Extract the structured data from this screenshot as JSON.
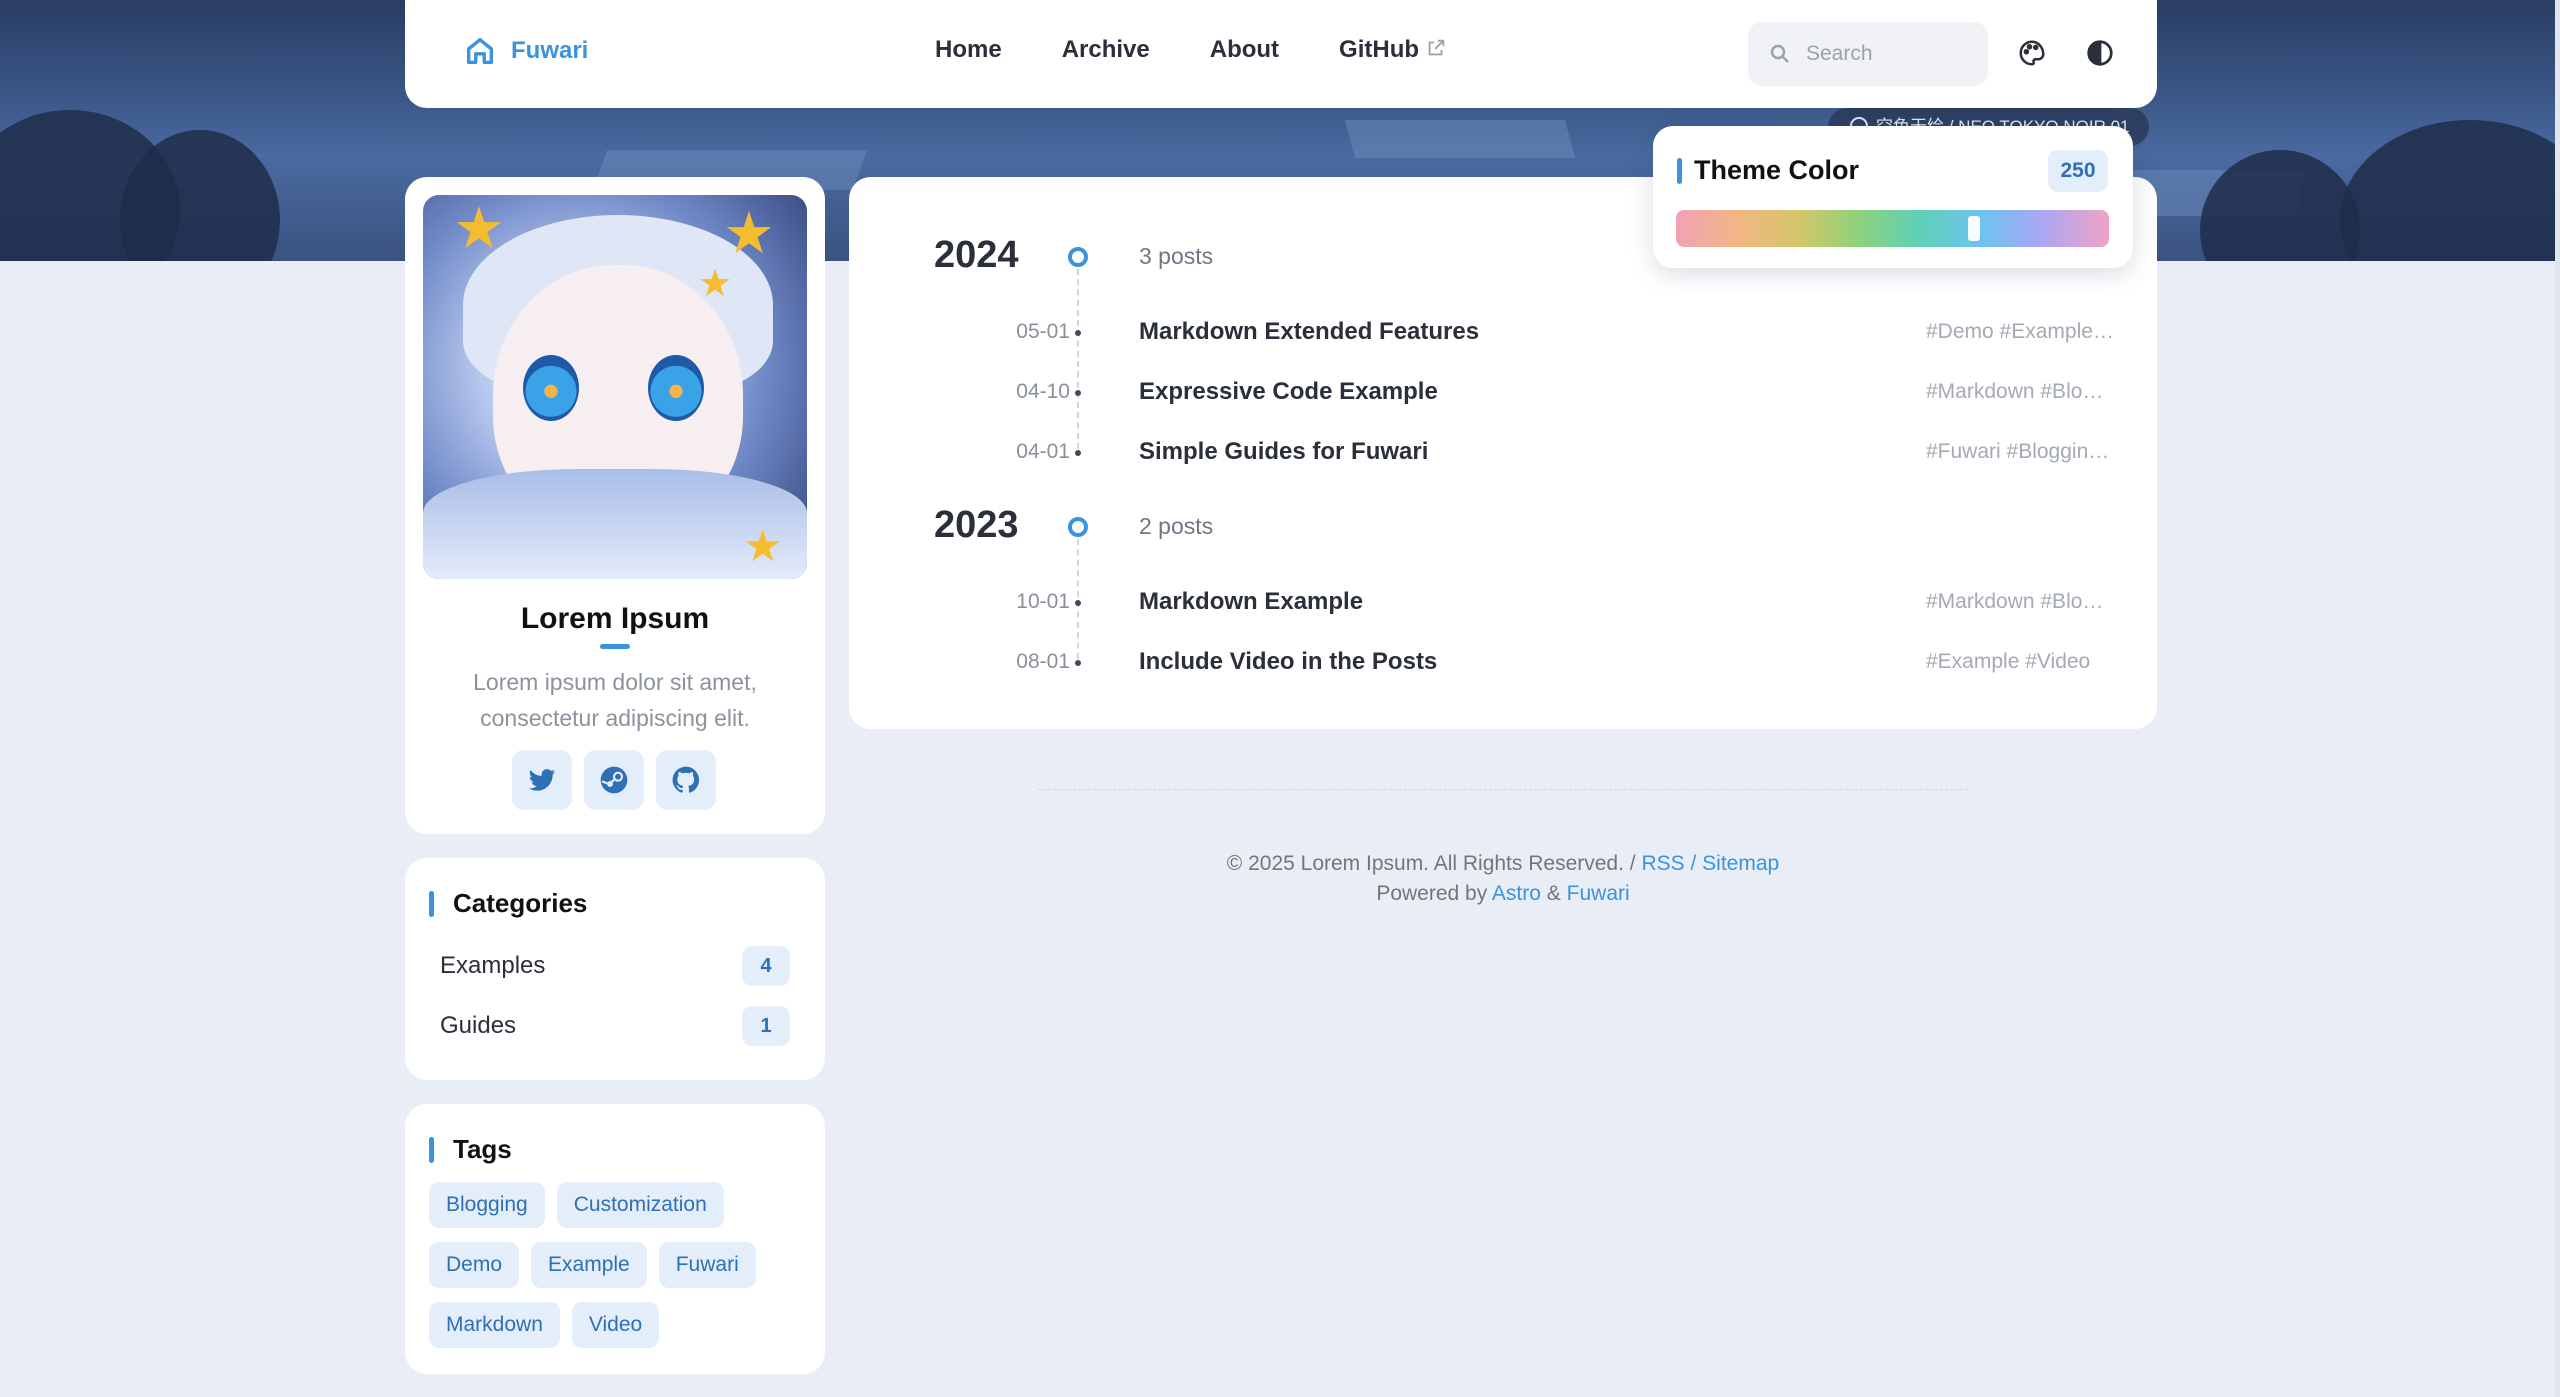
{
  "banner": {
    "credit": "空色天绘 / NEO TOKYO NOIR 01"
  },
  "navbar": {
    "brand": "Fuwari",
    "links": [
      "Home",
      "Archive",
      "About",
      "GitHub"
    ],
    "search_placeholder": "Search",
    "icons": [
      "home-icon",
      "external-link-icon",
      "search-icon",
      "palette-icon",
      "contrast-icon"
    ]
  },
  "profile": {
    "name": "Lorem Ipsum",
    "bio": "Lorem ipsum dolor sit amet, consectetur adipiscing elit.",
    "socials": [
      "twitter-icon",
      "steam-icon",
      "github-icon"
    ]
  },
  "categories": {
    "title": "Categories",
    "items": [
      {
        "name": "Examples",
        "count": "4"
      },
      {
        "name": "Guides",
        "count": "1"
      }
    ]
  },
  "tags": {
    "title": "Tags",
    "items": [
      "Blogging",
      "Customization",
      "Demo",
      "Example",
      "Fuwari",
      "Markdown",
      "Video"
    ]
  },
  "archive": {
    "years": [
      {
        "year": "2024",
        "count": "3 posts",
        "posts": [
          {
            "date": "05-01",
            "title": "Markdown Extended Features",
            "tags": "#Demo #Example…"
          },
          {
            "date": "04-10",
            "title": "Expressive Code Example",
            "tags": "#Markdown #Blo…"
          },
          {
            "date": "04-01",
            "title": "Simple Guides for Fuwari",
            "tags": "#Fuwari #Bloggin…"
          }
        ]
      },
      {
        "year": "2023",
        "count": "2 posts",
        "posts": [
          {
            "date": "10-01",
            "title": "Markdown Example",
            "tags": "#Markdown #Blo…"
          },
          {
            "date": "08-01",
            "title": "Include Video in the Posts",
            "tags": "#Example #Video"
          }
        ]
      }
    ]
  },
  "theme": {
    "title": "Theme Color",
    "hue": "250",
    "hue_fraction": 0.694
  },
  "footer": {
    "copyright": "© 2025 Lorem Ipsum. All Rights Reserved. /",
    "rss": "RSS",
    "sep": "/",
    "sitemap": "Sitemap",
    "powered": "Powered by",
    "astro": "Astro",
    "amp": "&",
    "fuwari": "Fuwari"
  },
  "colors": {
    "accent": "#3b93e0",
    "background": "#e9eef6",
    "badge_bg": "#e4eefa"
  }
}
